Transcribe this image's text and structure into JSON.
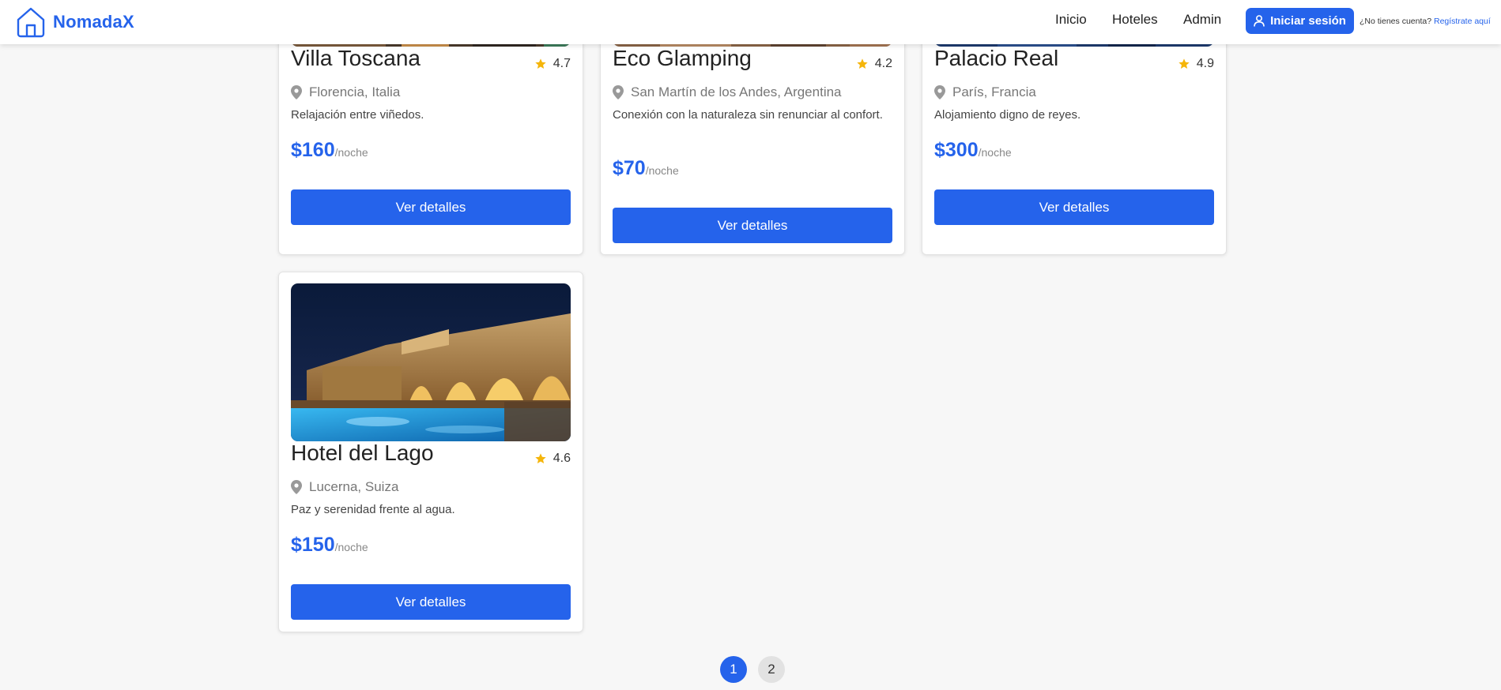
{
  "header": {
    "brand": "NomadaX",
    "nav": [
      "Inicio",
      "Hoteles",
      "Admin"
    ],
    "login_label": "Iniciar sesión",
    "signup_prompt": "¿No tienes cuenta?",
    "signup_link": "Regístrate aquí"
  },
  "colors": {
    "accent": "#2563eb",
    "star": "#f5b50a"
  },
  "hotels": [
    {
      "name": "Villa Toscana",
      "rating": "4.7",
      "location": "Florencia, Italia",
      "description": "Relajación entre viñedos.",
      "price": "$160",
      "price_unit": "/noche",
      "button": "Ver detalles"
    },
    {
      "name": "Eco Glamping",
      "rating": "4.2",
      "location": "San Martín de los Andes, Argentina",
      "description": "Conexión con la naturaleza sin renunciar al confort.",
      "price": "$70",
      "price_unit": "/noche",
      "button": "Ver detalles"
    },
    {
      "name": "Palacio Real",
      "rating": "4.9",
      "location": "París, Francia",
      "description": "Alojamiento digno de reyes.",
      "price": "$300",
      "price_unit": "/noche",
      "button": "Ver detalles"
    },
    {
      "name": "Hotel del Lago",
      "rating": "4.6",
      "location": "Lucerna, Suiza",
      "description": "Paz y serenidad frente al agua.",
      "price": "$150",
      "price_unit": "/noche",
      "button": "Ver detalles"
    }
  ],
  "pagination": {
    "pages": [
      "1",
      "2"
    ],
    "current": "1"
  }
}
